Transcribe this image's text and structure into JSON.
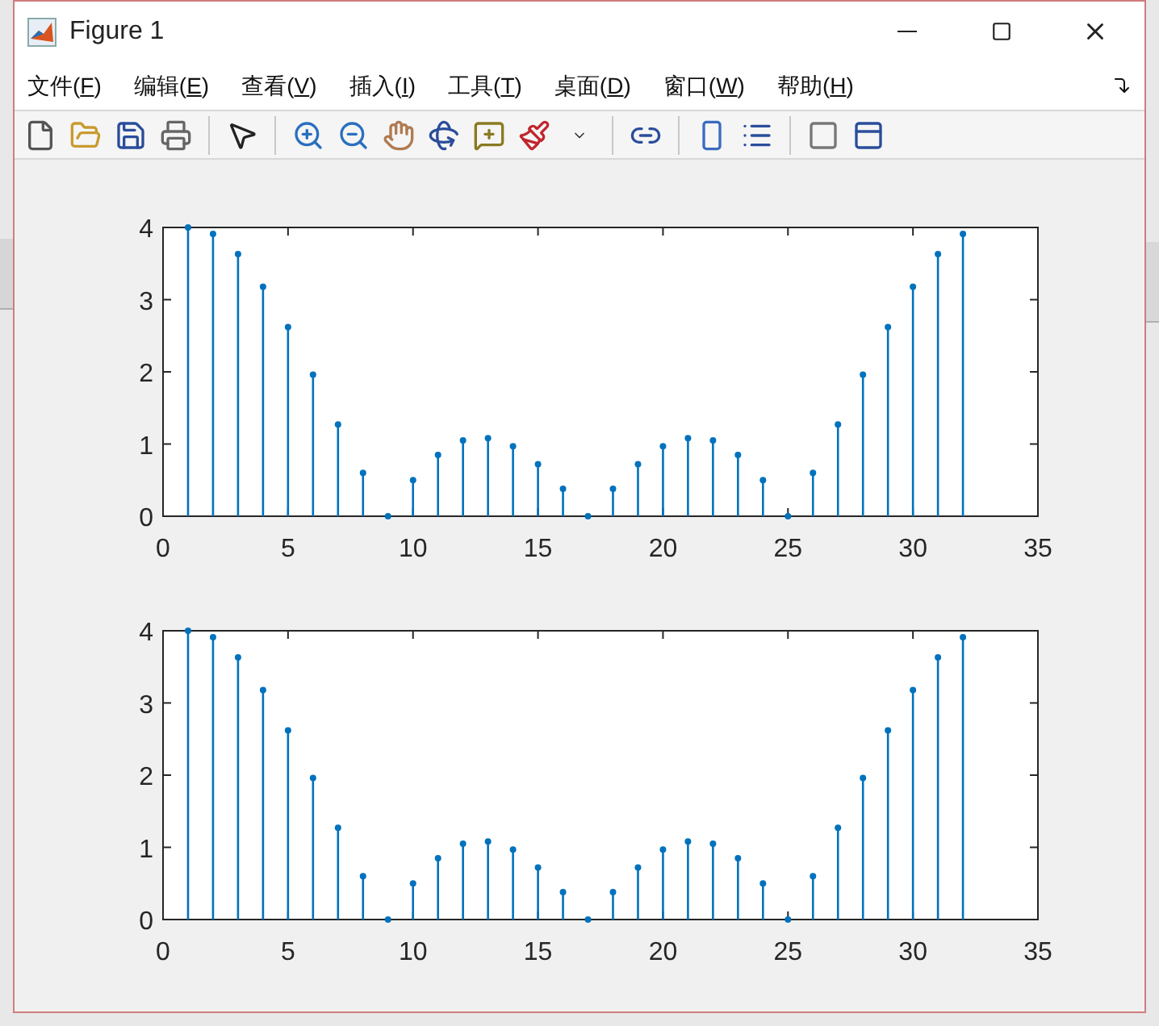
{
  "window": {
    "title": "Figure 1"
  },
  "menu": [
    "文件(F)",
    "编辑(E)",
    "查看(V)",
    "插入(I)",
    "工具(T)",
    "桌面(D)",
    "窗口(W)",
    "帮助(H)"
  ],
  "plots": [
    {
      "chart_data": {
        "type": "bar",
        "x": [
          1,
          2,
          3,
          4,
          5,
          6,
          7,
          8,
          9,
          10,
          11,
          12,
          13,
          14,
          15,
          16,
          17,
          18,
          19,
          20,
          21,
          22,
          23,
          24,
          25,
          26,
          27,
          28,
          29,
          30,
          31,
          32
        ],
        "values": [
          4,
          3.91,
          3.63,
          3.18,
          2.62,
          1.96,
          1.27,
          0.6,
          0,
          0.5,
          0.85,
          1.05,
          1.08,
          0.97,
          0.72,
          0.38,
          0,
          0.38,
          0.72,
          0.97,
          1.08,
          1.05,
          0.85,
          0.5,
          0,
          0.6,
          1.27,
          1.96,
          2.62,
          3.18,
          3.63,
          3.91
        ],
        "xlim": [
          0,
          35
        ],
        "ylim": [
          0,
          4
        ],
        "xticks": [
          0,
          5,
          10,
          15,
          20,
          25,
          30,
          35
        ],
        "yticks": [
          0,
          1,
          2,
          3,
          4
        ]
      }
    },
    {
      "chart_data": {
        "type": "bar",
        "x": [
          1,
          2,
          3,
          4,
          5,
          6,
          7,
          8,
          9,
          10,
          11,
          12,
          13,
          14,
          15,
          16,
          17,
          18,
          19,
          20,
          21,
          22,
          23,
          24,
          25,
          26,
          27,
          28,
          29,
          30,
          31,
          32
        ],
        "values": [
          4,
          3.91,
          3.63,
          3.18,
          2.62,
          1.96,
          1.27,
          0.6,
          0,
          0.5,
          0.85,
          1.05,
          1.08,
          0.97,
          0.72,
          0.38,
          0,
          0.38,
          0.72,
          0.97,
          1.08,
          1.05,
          0.85,
          0.5,
          0,
          0.6,
          1.27,
          1.96,
          2.62,
          3.18,
          3.63,
          3.91
        ],
        "xlim": [
          0,
          35
        ],
        "ylim": [
          0,
          4
        ],
        "xticks": [
          0,
          5,
          10,
          15,
          20,
          25,
          30,
          35
        ],
        "yticks": [
          0,
          1,
          2,
          3,
          4
        ]
      }
    }
  ]
}
